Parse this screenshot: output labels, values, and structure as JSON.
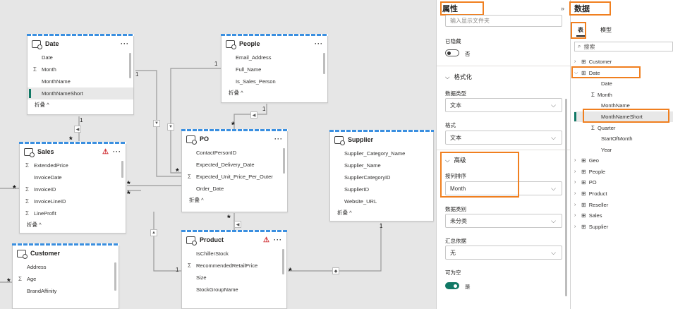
{
  "canvas": {
    "cards": {
      "date": {
        "name": "Date",
        "fields": [
          "Date",
          "Month",
          "MonthName",
          "MonthNameShort"
        ],
        "collapse": "折叠 ^"
      },
      "people": {
        "name": "People",
        "fields": [
          "Email_Address",
          "Full_Name",
          "Is_Sales_Person"
        ],
        "collapse": "折叠 ^"
      },
      "sales": {
        "name": "Sales",
        "fields": [
          "ExtendedPrice",
          "InvoiceDate",
          "InvoiceID",
          "InvoiceLineID",
          "LineProfit"
        ],
        "collapse": "折叠 ^"
      },
      "po": {
        "name": "PO",
        "fields": [
          "ContactPersonID",
          "Expected_Delivery_Date",
          "Expected_Unit_Price_Per_Outer",
          "Order_Date"
        ],
        "collapse": "折叠 ^"
      },
      "supplier": {
        "name": "Supplier",
        "fields": [
          "Supplier_Category_Name",
          "Supplier_Name",
          "SupplierCategoryID",
          "SupplierID",
          "Website_URL"
        ],
        "collapse": "折叠 ^"
      },
      "customer": {
        "name": "Customer",
        "fields": [
          "Address",
          "Age",
          "BrandAffinity"
        ]
      },
      "product": {
        "name": "Product",
        "fields": [
          "IsChillerStock",
          "RecommendedRetailPrice",
          "Size",
          "StockGroupName"
        ]
      }
    },
    "cardinality": {
      "one": "1",
      "many": "*"
    }
  },
  "properties": {
    "title": "属性",
    "folder_placeholder": "输入显示文件夹",
    "hidden_label": "已隐藏",
    "hidden_value": "否",
    "format_section": "格式化",
    "data_type_label": "数据类型",
    "data_type_value": "文本",
    "format_label": "格式",
    "format_value": "文本",
    "advanced_section": "高级",
    "sort_by_label": "按列排序",
    "sort_by_value": "Month",
    "data_category_label": "数据类别",
    "data_category_value": "未分类",
    "summarize_label": "汇总依据",
    "summarize_value": "无",
    "nullable_label": "可为空",
    "nullable_value": "是"
  },
  "data_pane": {
    "title": "数据",
    "tabs": [
      "表",
      "模型"
    ],
    "search_placeholder": "搜索",
    "tables": [
      {
        "name": "Customer",
        "expanded": false
      },
      {
        "name": "Date",
        "expanded": true,
        "children": [
          "Date",
          "Month",
          "MonthName",
          "MonthNameShort",
          "Quarter",
          "StartOfMonth",
          "Year"
        ]
      },
      {
        "name": "Geo",
        "expanded": false
      },
      {
        "name": "People",
        "expanded": false
      },
      {
        "name": "PO",
        "expanded": false
      },
      {
        "name": "Product",
        "expanded": false
      },
      {
        "name": "Reseller",
        "expanded": false
      },
      {
        "name": "Sales",
        "expanded": false
      },
      {
        "name": "Supplier",
        "expanded": false
      }
    ]
  },
  "colors": {
    "accent": "#117865",
    "highlight": "#f07f1f",
    "stripe": "#3a8fe0",
    "warning": "#d13438"
  }
}
